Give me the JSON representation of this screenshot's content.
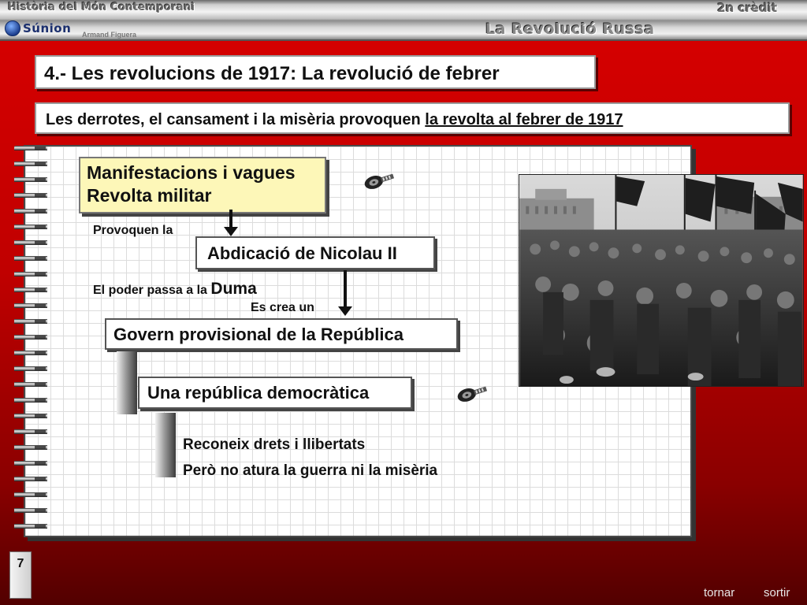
{
  "header": {
    "course": "Història del Món Contemporani",
    "credit": "2n crèdit",
    "unit": "La Revolució Russa",
    "logo_text": "Súnion",
    "author": "Armand Figuera"
  },
  "slide": {
    "title": "4.- Les revolucions de 1917: La revolució de febrer",
    "lead_prefix": "Les derrotes, el cansament i la misèria provoquen ",
    "lead_emphasis": "la revolta al febrer de 1917",
    "causes": [
      "Manifestacions i vagues",
      "Revolta militar"
    ],
    "provoke_label": "Provoquen la",
    "abdication": "Abdicació de Nicolau II",
    "power_label": "El poder passa a la ",
    "duma": "Duma",
    "creates_label": "Es crea un",
    "provisional_gov": "Govern provisional de la República",
    "republic": "Una república democràtica",
    "consequences": [
      "Reconeix drets i llibertats",
      "Però no atura la guerra ni la misèria"
    ]
  },
  "footer": {
    "page_number": "7",
    "back_label": "tornar",
    "exit_label": "sortir"
  },
  "colors": {
    "background": "#c00000",
    "note_box": "#fdf7b8"
  },
  "icons": [
    "film-reel-icon",
    "film-reel-icon"
  ]
}
